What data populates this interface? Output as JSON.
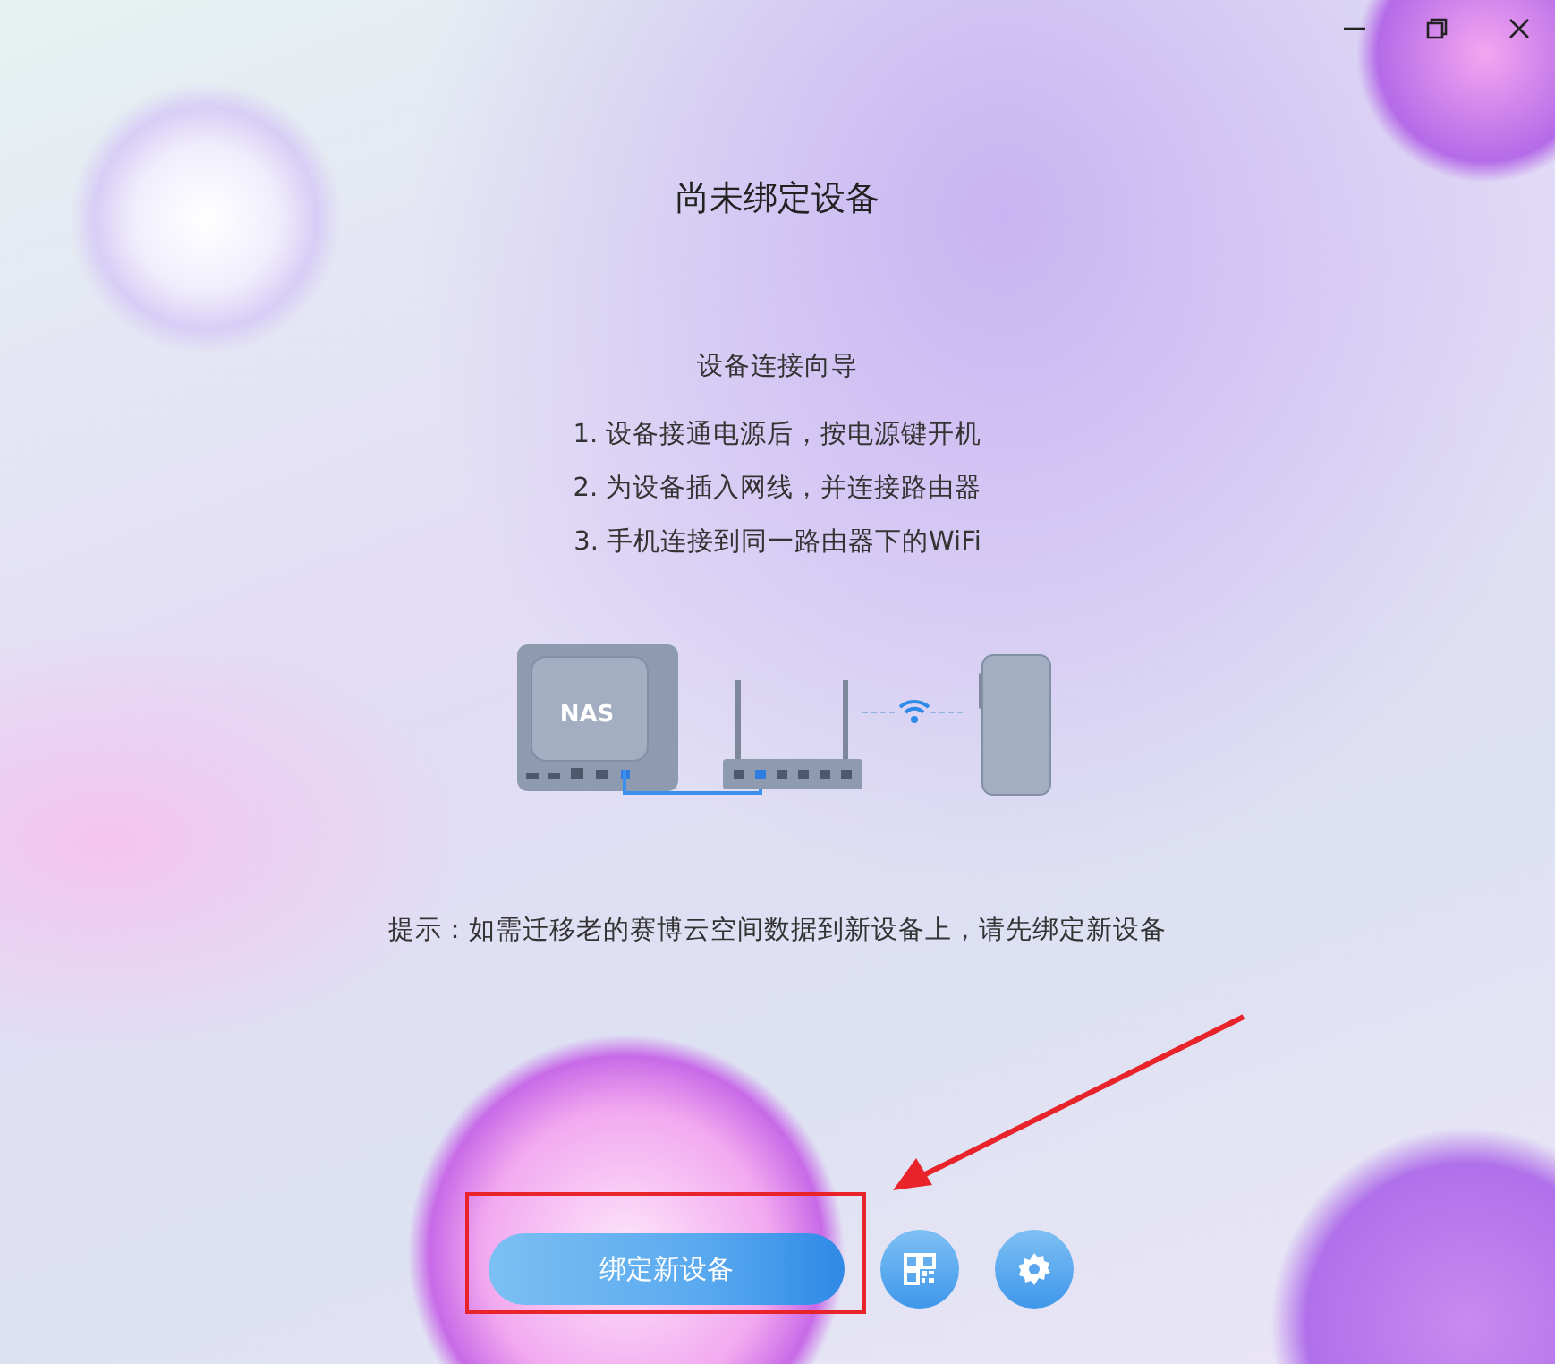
{
  "title": "尚未绑定设备",
  "guide": {
    "heading": "设备连接向导",
    "steps": [
      "1. 设备接通电源后，按电源键开机",
      "2. 为设备插入网线，并连接路由器",
      "3. 手机连接到同一路由器下的WiFi"
    ]
  },
  "illustration": {
    "device_label": "NAS"
  },
  "hint": "提示：如需迁移老的赛博云空间数据到新设备上，请先绑定新设备",
  "actions": {
    "primary": "绑定新设备"
  }
}
